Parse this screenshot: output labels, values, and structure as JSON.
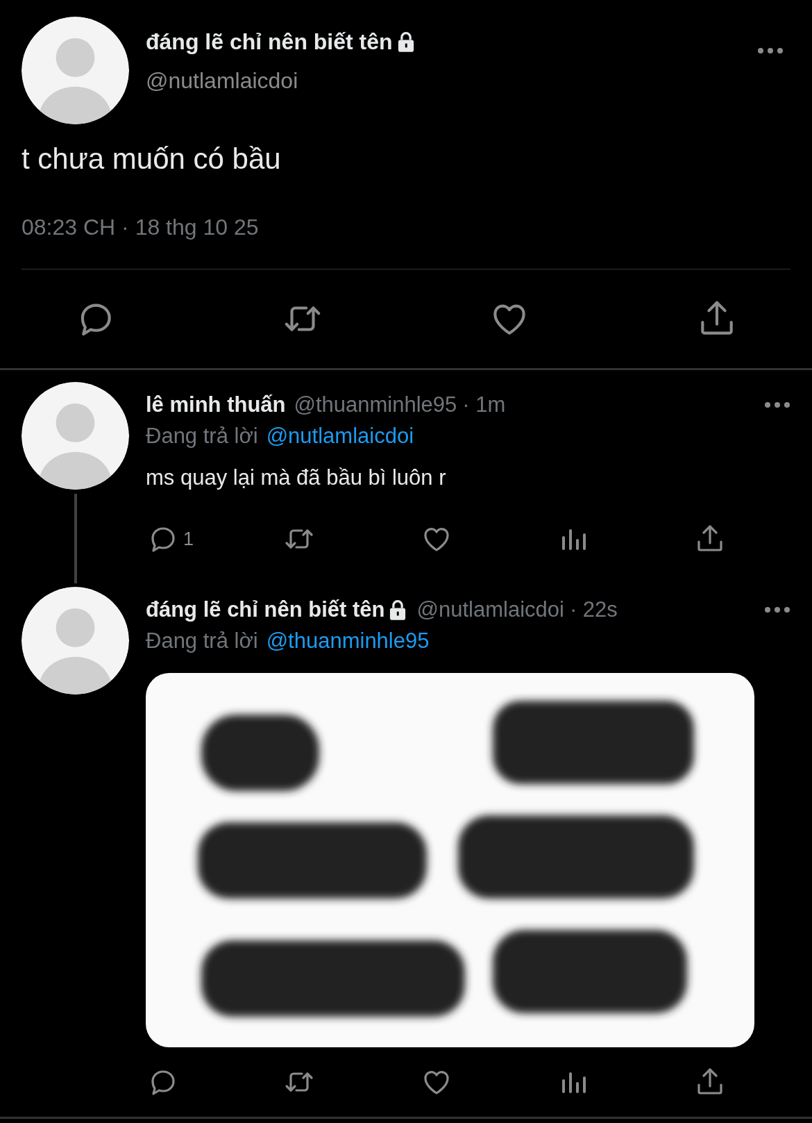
{
  "main_tweet": {
    "display_name": "đáng lẽ chỉ nên biết tên",
    "protected": true,
    "handle": "@nutlamlaicdoi",
    "text": "t chưa muốn có bầu",
    "timestamp": "08:23 CH · 18 thg 10 25",
    "actions": [
      {
        "kind": "reply"
      },
      {
        "kind": "retweet"
      },
      {
        "kind": "like"
      },
      {
        "kind": "share"
      }
    ]
  },
  "replies": [
    {
      "thread_line": true,
      "display_name": "lê minh thuấn",
      "protected": false,
      "handle": "@thuanminhle95",
      "time": "· 1m",
      "replying_label": "Đang trả lời",
      "replying_to": "@nutlamlaicdoi",
      "text": "ms quay lại mà đã bầu bì luôn r",
      "actions": [
        {
          "kind": "reply",
          "count": "1"
        },
        {
          "kind": "retweet"
        },
        {
          "kind": "like"
        },
        {
          "kind": "views"
        },
        {
          "kind": "share"
        }
      ]
    },
    {
      "thread_line": false,
      "display_name": "đáng lẽ chỉ nên biết tên",
      "protected": true,
      "handle": "@nutlamlaicdoi",
      "time": "· 22s",
      "replying_label": "Đang trả lời",
      "replying_to": "@thuanminhle95",
      "actions": [
        {
          "kind": "reply"
        },
        {
          "kind": "retweet"
        },
        {
          "kind": "like"
        },
        {
          "kind": "views"
        },
        {
          "kind": "share"
        }
      ]
    }
  ]
}
